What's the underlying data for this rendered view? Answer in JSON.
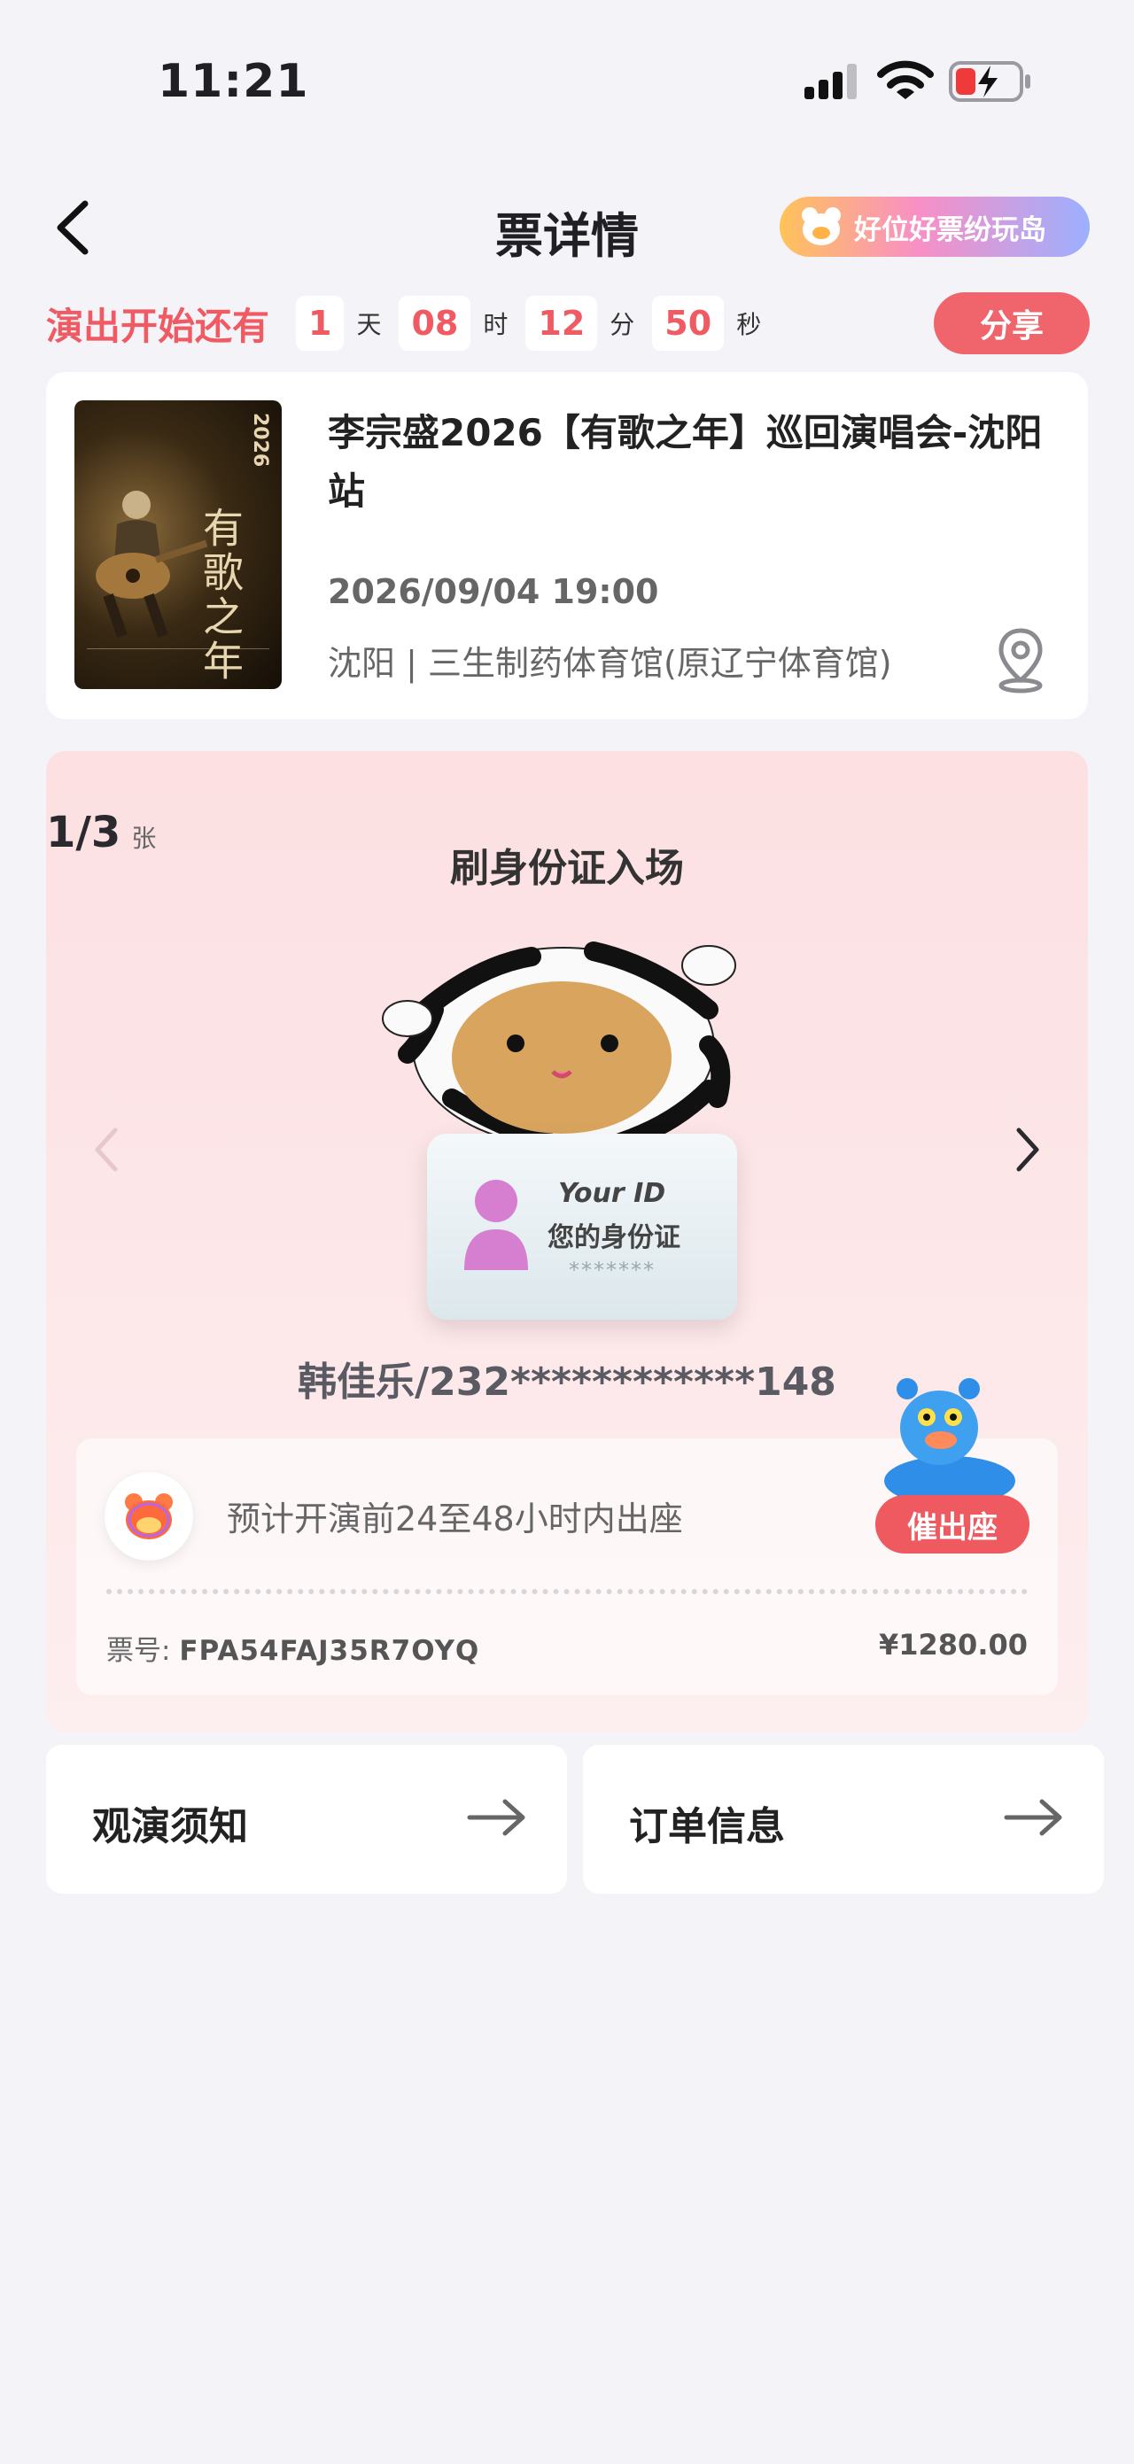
{
  "status_bar": {
    "time": "11:21"
  },
  "header": {
    "title": "票详情",
    "promo": "好位好票纷玩岛"
  },
  "countdown": {
    "label": "演出开始还有",
    "days": "1",
    "days_unit": "天",
    "hours": "08",
    "hours_unit": "时",
    "minutes": "12",
    "minutes_unit": "分",
    "seconds": "50",
    "seconds_unit": "秒"
  },
  "share_label": "分享",
  "event": {
    "title": "李宗盛2026【有歌之年】巡回演唱会-沈阳站",
    "datetime": "2026/09/04 19:00",
    "venue": "沈阳 | 三生制药体育馆(原辽宁体育馆)",
    "poster_year": "2026",
    "poster_title": "有歌之年"
  },
  "ticket": {
    "index": "1/3",
    "index_unit": "张",
    "entry_method": "刷身份证入场",
    "id_card_line1": "Your ID",
    "id_card_line2": "您的身份证",
    "id_card_mask": "*******",
    "holder": "韩佳乐/232************148",
    "seat_note": "预计开演前24至48小时内出座",
    "urge_label": "催出座",
    "number_label": "票号:",
    "number_value": "FPA54FAJ35R7OYQ",
    "price": "¥1280.00"
  },
  "bottom": {
    "notice_label": "观演须知",
    "order_label": "订单信息"
  },
  "colors": {
    "accent_red": "#f05a63",
    "panel_pink": "#fce0e2",
    "background": "#f4f4f8"
  }
}
